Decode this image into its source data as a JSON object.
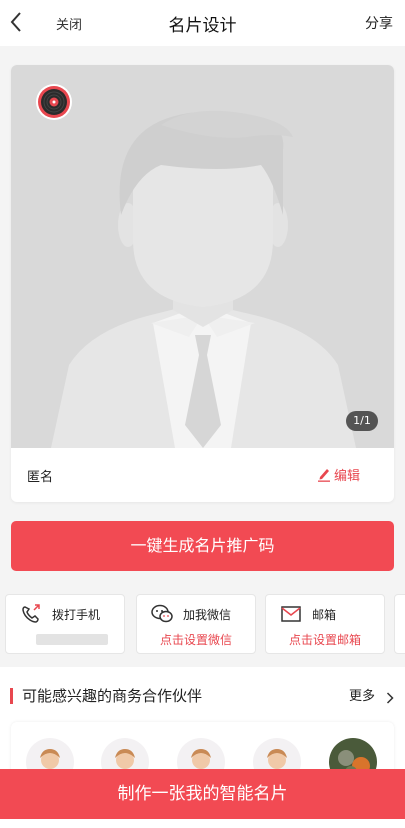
{
  "header": {
    "close_label": "关闭",
    "title": "名片设计",
    "share_label": "分享"
  },
  "card": {
    "page_indicator": "1/1",
    "name": "匿名",
    "edit_label": "编辑"
  },
  "generate_button": "一键生成名片推广码",
  "contacts": [
    {
      "label": "拨打手机",
      "icon": "phone-icon",
      "sub": ""
    },
    {
      "label": "加我微信",
      "icon": "wechat-icon",
      "sub": "点击设置微信"
    },
    {
      "label": "邮箱",
      "icon": "mail-icon",
      "sub": "点击设置邮箱"
    }
  ],
  "partners": {
    "title": "可能感兴趣的商务合作伙伴",
    "more_label": "更多"
  },
  "cta_label": "制作一张我的智能名片",
  "colors": {
    "accent": "#f24a53",
    "accent_text": "#e8474f",
    "photo_bg": "#d9d9d9"
  }
}
